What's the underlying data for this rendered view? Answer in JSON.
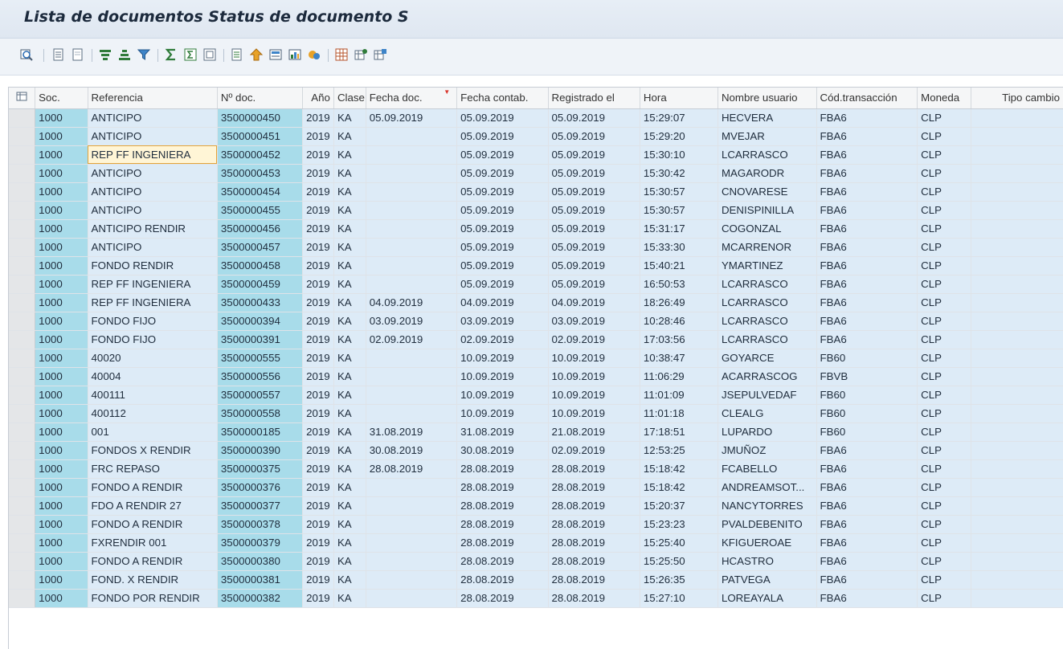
{
  "window": {
    "title": "Lista de documentos Status de documento S"
  },
  "toolbar": {
    "icons": [
      "details-icon",
      "select-all-icon",
      "deselect-all-icon",
      "sort-ascending-icon",
      "sort-descending-icon",
      "filter-icon",
      "total-icon",
      "subtotal-icon",
      "collapse-icon",
      "print-preview-icon",
      "export-icon",
      "word-processing-icon",
      "graphic-icon",
      "abc-analysis-icon",
      "layout-icon",
      "choose-layout-icon",
      "save-layout-icon"
    ]
  },
  "table": {
    "columns": [
      "Soc.",
      "Referencia",
      "Nº doc.",
      "Año",
      "Clase",
      "Fecha doc.",
      "Fecha contab.",
      "Registrado el",
      "Hora",
      "Nombre usuario",
      "Cód.transacción",
      "Moneda",
      "Tipo cambio"
    ],
    "sort_indicator": "▼",
    "rows": [
      [
        "1000",
        "ANTICIPO",
        "3500000450",
        "2019",
        "KA",
        "05.09.2019",
        "05.09.2019",
        "05.09.2019",
        "15:29:07",
        "HECVERA",
        "FBA6",
        "CLP",
        ""
      ],
      [
        "1000",
        "ANTICIPO",
        "3500000451",
        "2019",
        "KA",
        "",
        "05.09.2019",
        "05.09.2019",
        "15:29:20",
        "MVEJAR",
        "FBA6",
        "CLP",
        ""
      ],
      [
        "1000",
        "REP FF INGENIERA",
        "3500000452",
        "2019",
        "KA",
        "",
        "05.09.2019",
        "05.09.2019",
        "15:30:10",
        "LCARRASCO",
        "FBA6",
        "CLP",
        ""
      ],
      [
        "1000",
        "ANTICIPO",
        "3500000453",
        "2019",
        "KA",
        "",
        "05.09.2019",
        "05.09.2019",
        "15:30:42",
        "MAGARODR",
        "FBA6",
        "CLP",
        ""
      ],
      [
        "1000",
        "ANTICIPO",
        "3500000454",
        "2019",
        "KA",
        "",
        "05.09.2019",
        "05.09.2019",
        "15:30:57",
        "CNOVARESE",
        "FBA6",
        "CLP",
        ""
      ],
      [
        "1000",
        "ANTICIPO",
        "3500000455",
        "2019",
        "KA",
        "",
        "05.09.2019",
        "05.09.2019",
        "15:30:57",
        "DENISPINILLA",
        "FBA6",
        "CLP",
        ""
      ],
      [
        "1000",
        "ANTICIPO RENDIR",
        "3500000456",
        "2019",
        "KA",
        "",
        "05.09.2019",
        "05.09.2019",
        "15:31:17",
        "COGONZAL",
        "FBA6",
        "CLP",
        ""
      ],
      [
        "1000",
        "ANTICIPO",
        "3500000457",
        "2019",
        "KA",
        "",
        "05.09.2019",
        "05.09.2019",
        "15:33:30",
        "MCARRENOR",
        "FBA6",
        "CLP",
        ""
      ],
      [
        "1000",
        "FONDO RENDIR",
        "3500000458",
        "2019",
        "KA",
        "",
        "05.09.2019",
        "05.09.2019",
        "15:40:21",
        "YMARTINEZ",
        "FBA6",
        "CLP",
        ""
      ],
      [
        "1000",
        "REP FF INGENIERA",
        "3500000459",
        "2019",
        "KA",
        "",
        "05.09.2019",
        "05.09.2019",
        "16:50:53",
        "LCARRASCO",
        "FBA6",
        "CLP",
        ""
      ],
      [
        "1000",
        "REP FF INGENIERA",
        "3500000433",
        "2019",
        "KA",
        "04.09.2019",
        "04.09.2019",
        "04.09.2019",
        "18:26:49",
        "LCARRASCO",
        "FBA6",
        "CLP",
        ""
      ],
      [
        "1000",
        "FONDO FIJO",
        "3500000394",
        "2019",
        "KA",
        "03.09.2019",
        "03.09.2019",
        "03.09.2019",
        "10:28:46",
        "LCARRASCO",
        "FBA6",
        "CLP",
        ""
      ],
      [
        "1000",
        "FONDO FIJO",
        "3500000391",
        "2019",
        "KA",
        "02.09.2019",
        "02.09.2019",
        "02.09.2019",
        "17:03:56",
        "LCARRASCO",
        "FBA6",
        "CLP",
        ""
      ],
      [
        "1000",
        "40020",
        "3500000555",
        "2019",
        "KA",
        "",
        "10.09.2019",
        "10.09.2019",
        "10:38:47",
        "GOYARCE",
        "FB60",
        "CLP",
        ""
      ],
      [
        "1000",
        "40004",
        "3500000556",
        "2019",
        "KA",
        "",
        "10.09.2019",
        "10.09.2019",
        "11:06:29",
        "ACARRASCOG",
        "FBVB",
        "CLP",
        ""
      ],
      [
        "1000",
        "400111",
        "3500000557",
        "2019",
        "KA",
        "",
        "10.09.2019",
        "10.09.2019",
        "11:01:09",
        "JSEPULVEDAF",
        "FB60",
        "CLP",
        ""
      ],
      [
        "1000",
        "400112",
        "3500000558",
        "2019",
        "KA",
        "",
        "10.09.2019",
        "10.09.2019",
        "11:01:18",
        "CLEALG",
        "FB60",
        "CLP",
        ""
      ],
      [
        "1000",
        "001",
        "3500000185",
        "2019",
        "KA",
        "31.08.2019",
        "31.08.2019",
        "21.08.2019",
        "17:18:51",
        "LUPARDO",
        "FB60",
        "CLP",
        ""
      ],
      [
        "1000",
        "FONDOS X RENDIR",
        "3500000390",
        "2019",
        "KA",
        "30.08.2019",
        "30.08.2019",
        "02.09.2019",
        "12:53:25",
        "JMUÑOZ",
        "FBA6",
        "CLP",
        ""
      ],
      [
        "1000",
        "FRC REPASO",
        "3500000375",
        "2019",
        "KA",
        "28.08.2019",
        "28.08.2019",
        "28.08.2019",
        "15:18:42",
        "FCABELLO",
        "FBA6",
        "CLP",
        ""
      ],
      [
        "1000",
        "FONDO A RENDIR",
        "3500000376",
        "2019",
        "KA",
        "",
        "28.08.2019",
        "28.08.2019",
        "15:18:42",
        "ANDREAMSOT...",
        "FBA6",
        "CLP",
        ""
      ],
      [
        "1000",
        "FDO A RENDIR 27",
        "3500000377",
        "2019",
        "KA",
        "",
        "28.08.2019",
        "28.08.2019",
        "15:20:37",
        "NANCYTORRES",
        "FBA6",
        "CLP",
        ""
      ],
      [
        "1000",
        "FONDO A RENDIR",
        "3500000378",
        "2019",
        "KA",
        "",
        "28.08.2019",
        "28.08.2019",
        "15:23:23",
        "PVALDEBENITO",
        "FBA6",
        "CLP",
        ""
      ],
      [
        "1000",
        "FXRENDIR 001",
        "3500000379",
        "2019",
        "KA",
        "",
        "28.08.2019",
        "28.08.2019",
        "15:25:40",
        "KFIGUEROAE",
        "FBA6",
        "CLP",
        ""
      ],
      [
        "1000",
        "FONDO A RENDIR",
        "3500000380",
        "2019",
        "KA",
        "",
        "28.08.2019",
        "28.08.2019",
        "15:25:50",
        "HCASTRO",
        "FBA6",
        "CLP",
        ""
      ],
      [
        "1000",
        "FOND. X RENDIR",
        "3500000381",
        "2019",
        "KA",
        "",
        "28.08.2019",
        "28.08.2019",
        "15:26:35",
        "PATVEGA",
        "FBA6",
        "CLP",
        ""
      ],
      [
        "1000",
        "FONDO POR RENDIR",
        "3500000382",
        "2019",
        "KA",
        "",
        "28.08.2019",
        "28.08.2019",
        "15:27:10",
        "LOREAYALA",
        "FBA6",
        "CLP",
        ""
      ]
    ],
    "focused_cell": {
      "row": 2,
      "col": 1
    }
  },
  "colors": {
    "row_bg": "#ddebf7",
    "key_col_bg": "#a8dcea",
    "header_bg": "#f5f6f7",
    "title_bg": "#e7eef6"
  }
}
